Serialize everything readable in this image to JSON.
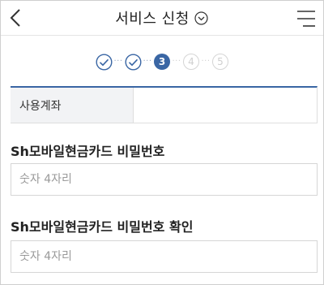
{
  "header": {
    "title": "서비스 신청",
    "back_icon": "chevron-left-icon",
    "dropdown_icon": "chevron-down-circle-icon",
    "menu_icon": "hamburger-menu-icon"
  },
  "steps": [
    {
      "label": "",
      "state": "done"
    },
    {
      "label": "",
      "state": "done"
    },
    {
      "label": "3",
      "state": "active"
    },
    {
      "label": "4",
      "state": "pending"
    },
    {
      "label": "5",
      "state": "pending"
    }
  ],
  "account": {
    "label": "사용계좌",
    "value": ""
  },
  "password": {
    "label": "Sh모바일현금카드 비밀번호",
    "placeholder": "숫자 4자리",
    "value": ""
  },
  "password_confirm": {
    "label": "Sh모바일현금카드 비밀번호 확인",
    "placeholder": "숫자 4자리",
    "value": ""
  },
  "colors": {
    "accent": "#3a66a4",
    "pending": "#d5d5d5"
  }
}
